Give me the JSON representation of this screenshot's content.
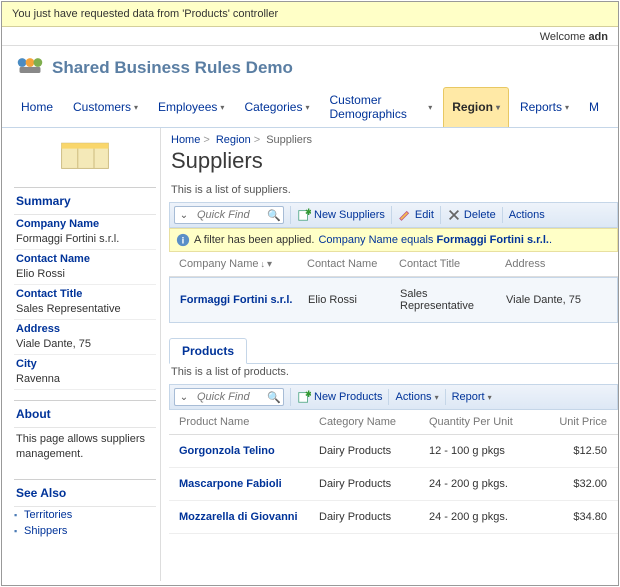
{
  "alert": "You just have requested data from 'Products' controller",
  "welcome": {
    "prefix": "Welcome ",
    "user": "adn"
  },
  "header": {
    "title": "Shared Business Rules Demo"
  },
  "nav": [
    {
      "label": "Home",
      "dd": false
    },
    {
      "label": "Customers",
      "dd": true
    },
    {
      "label": "Employees",
      "dd": true
    },
    {
      "label": "Categories",
      "dd": true
    },
    {
      "label": "Customer Demographics",
      "dd": true
    },
    {
      "label": "Region",
      "dd": true,
      "active": true
    },
    {
      "label": "Reports",
      "dd": true
    },
    {
      "label": "M",
      "dd": false
    }
  ],
  "sidebar": {
    "summary_title": "Summary",
    "fields": [
      {
        "label": "Company Name",
        "value": "Formaggi Fortini s.r.l."
      },
      {
        "label": "Contact Name",
        "value": "Elio Rossi"
      },
      {
        "label": "Contact Title",
        "value": "Sales Representative"
      },
      {
        "label": "Address",
        "value": "Viale Dante, 75"
      },
      {
        "label": "City",
        "value": "Ravenna"
      }
    ],
    "about_title": "About",
    "about_text": "This page allows suppliers management.",
    "seealso_title": "See Also",
    "links": [
      "Territories",
      "Shippers"
    ]
  },
  "breadcrumb": [
    "Home",
    "Region",
    "Suppliers"
  ],
  "page_title": "Suppliers",
  "suppliers": {
    "desc": "This is a list of suppliers.",
    "quickfind": "Quick Find",
    "toolbar": {
      "new": "New Suppliers",
      "edit": "Edit",
      "delete": "Delete",
      "actions": "Actions"
    },
    "filter_text_prefix": "A filter has been applied. ",
    "filter_link": "Company Name equals ",
    "filter_value": "Formaggi Fortini s.r.l.",
    "columns": [
      "Company Name",
      "Contact Name",
      "Contact Title",
      "Address"
    ],
    "rows": [
      {
        "company": "Formaggi Fortini s.r.l.",
        "contact": "Elio Rossi",
        "title": "Sales Representative",
        "address": "Viale Dante, 75"
      }
    ]
  },
  "products": {
    "tab": "Products",
    "desc": "This is a list of products.",
    "quickfind": "Quick Find",
    "toolbar": {
      "new": "New Products",
      "actions": "Actions",
      "report": "Report"
    },
    "columns": [
      "Product Name",
      "Category Name",
      "Quantity Per Unit",
      "Unit Price"
    ],
    "rows": [
      {
        "name": "Gorgonzola Telino",
        "cat": "Dairy Products",
        "qty": "12 - 100 g pkgs",
        "price": "$12.50"
      },
      {
        "name": "Mascarpone Fabioli",
        "cat": "Dairy Products",
        "qty": "24 - 200 g pkgs.",
        "price": "$32.00"
      },
      {
        "name": "Mozzarella di Giovanni",
        "cat": "Dairy Products",
        "qty": "24 - 200 g pkgs.",
        "price": "$34.80"
      }
    ]
  }
}
